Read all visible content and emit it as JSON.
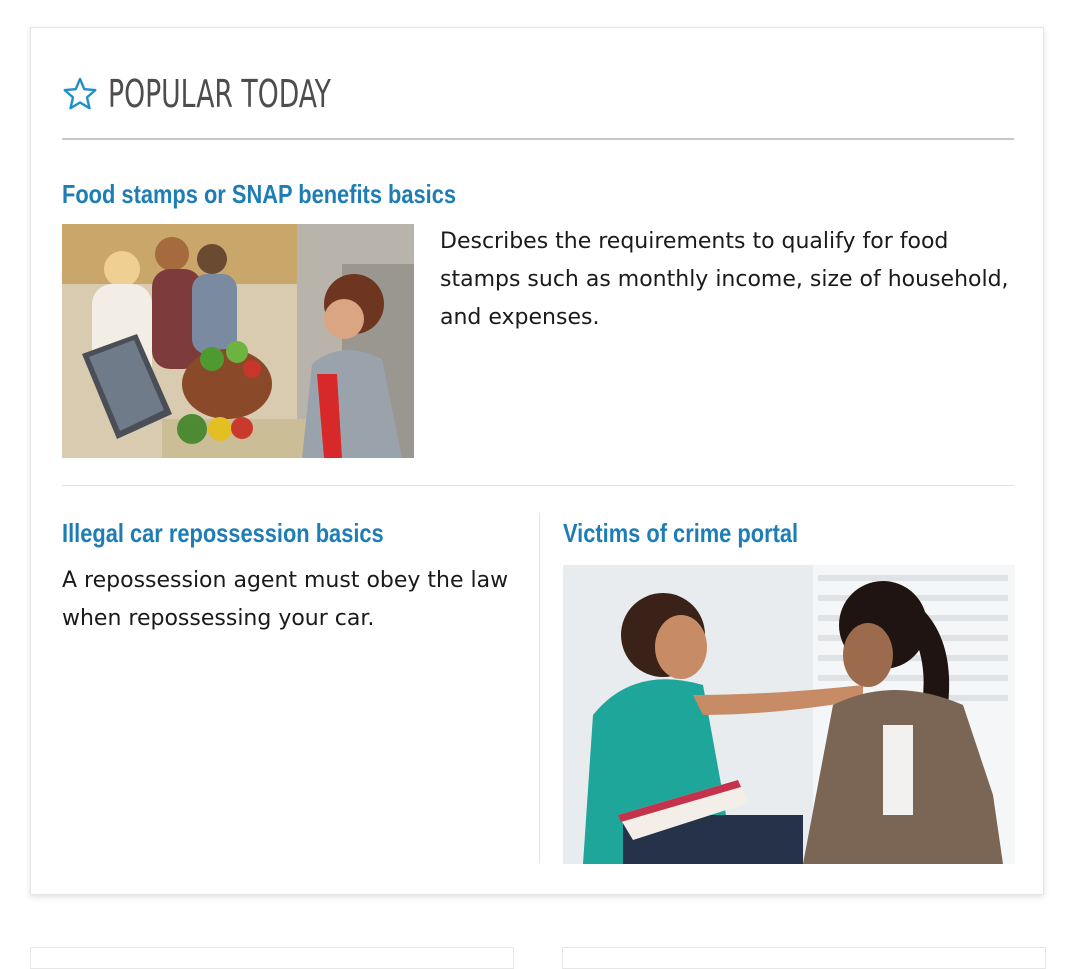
{
  "popular": {
    "heading": "POPULAR TODAY",
    "icon": "star-icon",
    "accent_color": "#1f7db6",
    "articles": [
      {
        "title": "Food stamps or SNAP benefits basics",
        "description": "Describes the requirements to qualify for food stamps such as monthly income, size of household, and expenses.",
        "image": "grocery-checkout-photo"
      },
      {
        "title": "Illegal car repossession basics",
        "description": "A repossession agent must obey the law when repossessing your car."
      },
      {
        "title": "Victims of crime portal",
        "image": "counselor-comforting-woman-photo"
      }
    ]
  }
}
